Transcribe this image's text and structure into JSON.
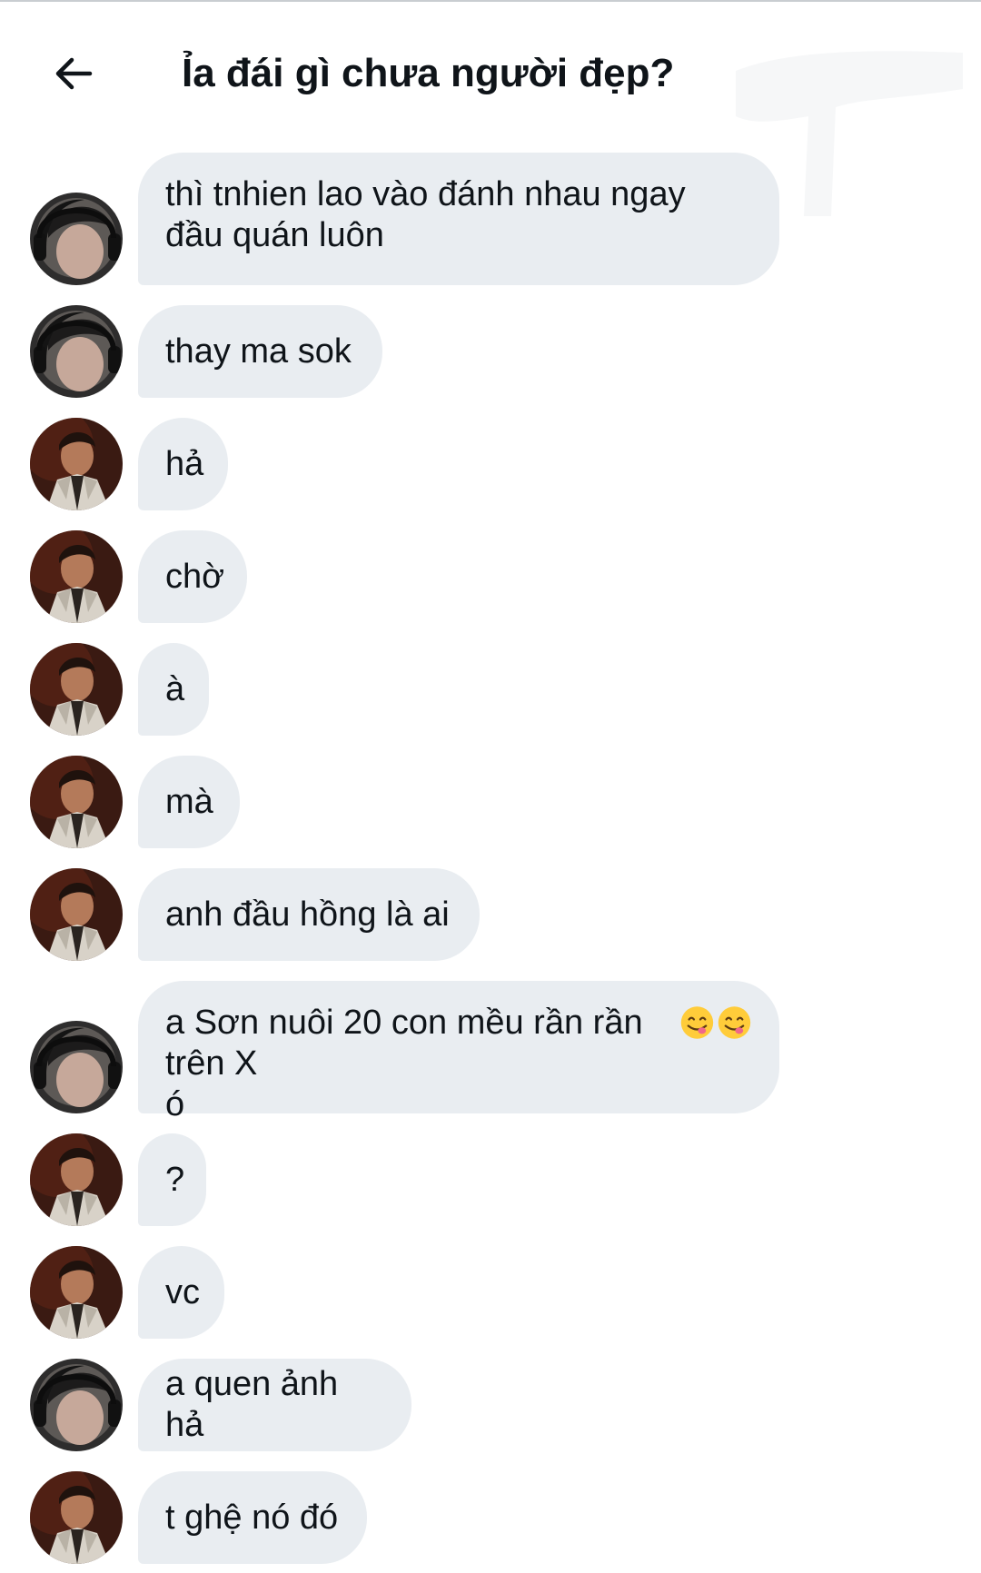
{
  "header": {
    "title": "Ỉa đái gì chưa người đẹp?",
    "back_icon": "arrow-left-icon"
  },
  "colors": {
    "bubble_bg": "#e9edf1",
    "text": "#0f1419",
    "background": "#ffffff"
  },
  "messages": [
    {
      "sender": "headphones-user",
      "text": "thì tnhien lao vào đánh nhau ngay\nđầu quán luôn"
    },
    {
      "sender": "headphones-user",
      "text": "thay ma sok"
    },
    {
      "sender": "suit-user",
      "text": "hả"
    },
    {
      "sender": "suit-user",
      "text": "chờ"
    },
    {
      "sender": "suit-user",
      "text": "à"
    },
    {
      "sender": "suit-user",
      "text": "mà"
    },
    {
      "sender": "suit-user",
      "text": "anh đầu hồng là ai"
    },
    {
      "sender": "headphones-user",
      "text": "a Sơn nuôi 20 con mều rần rần trên X\nó",
      "emoji": "face-savoring-food-emoji x2"
    },
    {
      "sender": "suit-user",
      "text": "?"
    },
    {
      "sender": "suit-user",
      "text": "vc"
    },
    {
      "sender": "headphones-user",
      "text": "a quen ảnh hả"
    },
    {
      "sender": "suit-user",
      "text": "t ghệ nó đó"
    }
  ]
}
